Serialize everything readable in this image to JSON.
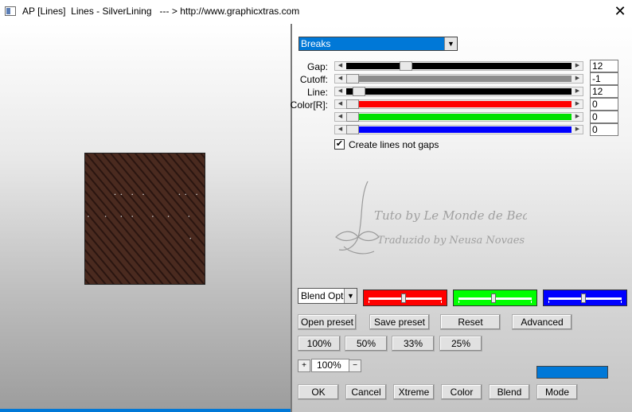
{
  "window": {
    "title": "AP [Lines]  Lines - SilverLining   --- > http://www.graphicxtras.com",
    "close_glyph": "✕"
  },
  "preset": {
    "selected": "Breaks"
  },
  "sliders": [
    {
      "label": "Gap:",
      "value": "12",
      "level": 0.25,
      "fill": "#000000"
    },
    {
      "label": "Cutoff:",
      "value": "-1",
      "level": 0.0,
      "fill": "#8c8c8c"
    },
    {
      "label": "Line:",
      "value": "12",
      "level": 0.03,
      "fill": "#000000"
    },
    {
      "label": "Color[R]:",
      "value": "0",
      "level": 0.0,
      "fill": "#ff0000"
    },
    {
      "label": "",
      "value": "0",
      "level": 0.0,
      "fill": "#00e000"
    },
    {
      "label": "",
      "value": "0",
      "level": 0.0,
      "fill": "#0000ff"
    }
  ],
  "checkbox": {
    "label": "Create lines not gaps",
    "checked": true
  },
  "watermark": {
    "line1": "Tuto by Le Monde de Bea",
    "line2": "Traduzido by Neusa Novaes"
  },
  "blend": {
    "selected": "Blend Options"
  },
  "channels": [
    {
      "color": "#ff0000",
      "level": 0.5
    },
    {
      "color": "#00ff00",
      "level": 0.5
    },
    {
      "color": "#0000ff",
      "level": 0.5
    }
  ],
  "buttons": {
    "open_preset": "Open preset",
    "save_preset": "Save preset",
    "reset": "Reset",
    "advanced": "Advanced",
    "z100": "100%",
    "z50": "50%",
    "z33": "33%",
    "z25": "25%",
    "ok": "OK",
    "cancel": "Cancel",
    "xtreme": "Xtreme",
    "color": "Color",
    "blend": "Blend",
    "mode": "Mode"
  },
  "zoom": {
    "value": "100%",
    "minus": "−",
    "plus": "+"
  },
  "swatch_color": "#0078d7",
  "preview_colors": {
    "base": "#4a2a1f",
    "stripe": "#2a1510"
  }
}
